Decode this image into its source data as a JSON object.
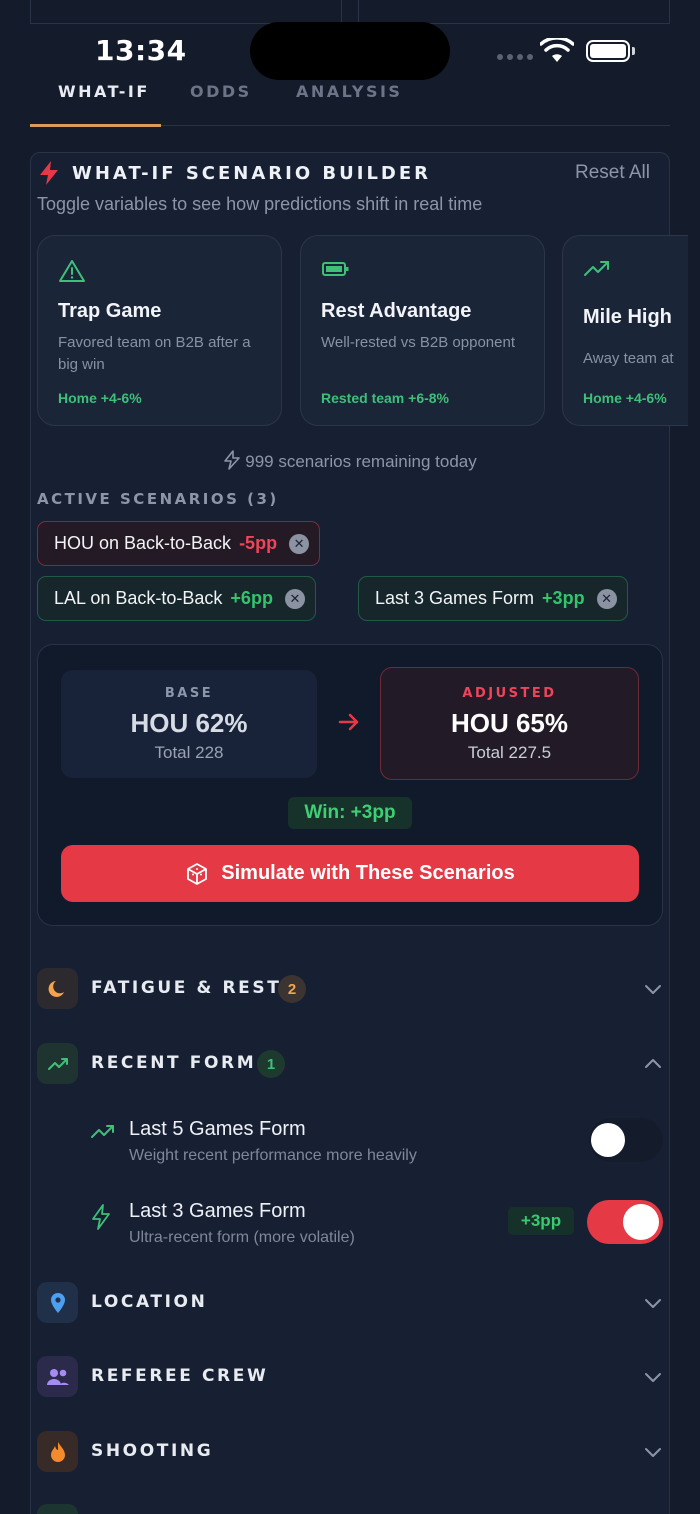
{
  "status": {
    "time": "13:34"
  },
  "tabs": [
    {
      "label": "WHAT-IF",
      "active": true
    },
    {
      "label": "ODDS",
      "active": false
    },
    {
      "label": "ANALYSIS",
      "active": false
    }
  ],
  "builder": {
    "title": "WHAT-IF SCENARIO BUILDER",
    "reset_label": "Reset All",
    "subtitle": "Toggle variables to see how predictions shift in real time"
  },
  "cards": [
    {
      "icon": "warning-triangle-icon",
      "title": "Trap Game",
      "desc": "Favored team on B2B after a big win",
      "effect": "Home +4-6%"
    },
    {
      "icon": "battery-icon",
      "title": "Rest Advantage",
      "desc": "Well-rested vs B2B opponent",
      "effect": "Rested team +6-8%"
    },
    {
      "icon": "trending-up-icon",
      "title": "Mile High",
      "desc": "Away team at",
      "effect": "Home +4-6%"
    }
  ],
  "remaining_text": "999 scenarios remaining today",
  "active_label": "ACTIVE SCENARIOS (3)",
  "active_chips": [
    {
      "label": "HOU on Back-to-Back",
      "delta": "-5pp",
      "tone": "red"
    },
    {
      "label": "LAL on Back-to-Back",
      "delta": "+6pp",
      "tone": "green"
    },
    {
      "label": "Last 3 Games Form",
      "delta": "+3pp",
      "tone": "green"
    }
  ],
  "result": {
    "base_label": "BASE",
    "base_value": "HOU 62%",
    "base_total": "Total 228",
    "adjusted_label": "ADJUSTED",
    "adjusted_value": "HOU 65%",
    "adjusted_total": "Total 227.5",
    "win_delta": "Win: +3pp",
    "simulate_label": "Simulate with These Scenarios"
  },
  "sections": [
    {
      "label": "FATIGUE & REST",
      "badge": "2",
      "icon": "moon-icon",
      "expanded": false
    },
    {
      "label": "RECENT FORM",
      "badge": "1",
      "icon": "trending-up-icon",
      "expanded": true
    },
    {
      "label": "LOCATION",
      "icon": "map-pin-icon",
      "expanded": false
    },
    {
      "label": "REFEREE CREW",
      "icon": "users-icon",
      "expanded": false
    },
    {
      "label": "SHOOTING",
      "icon": "flame-icon",
      "expanded": false
    }
  ],
  "recent_form_items": [
    {
      "title": "Last 5 Games Form",
      "desc": "Weight recent performance more heavily",
      "enabled": false,
      "icon": "trending-up-icon"
    },
    {
      "title": "Last 3 Games Form",
      "desc": "Ultra-recent form (more volatile)",
      "enabled": true,
      "delta": "+3pp",
      "icon": "bolt-icon"
    }
  ],
  "colors": {
    "accent_red": "#e63946",
    "accent_green": "#3ecf74",
    "tab_underline": "#d99a5b",
    "background": "#141b2b"
  }
}
